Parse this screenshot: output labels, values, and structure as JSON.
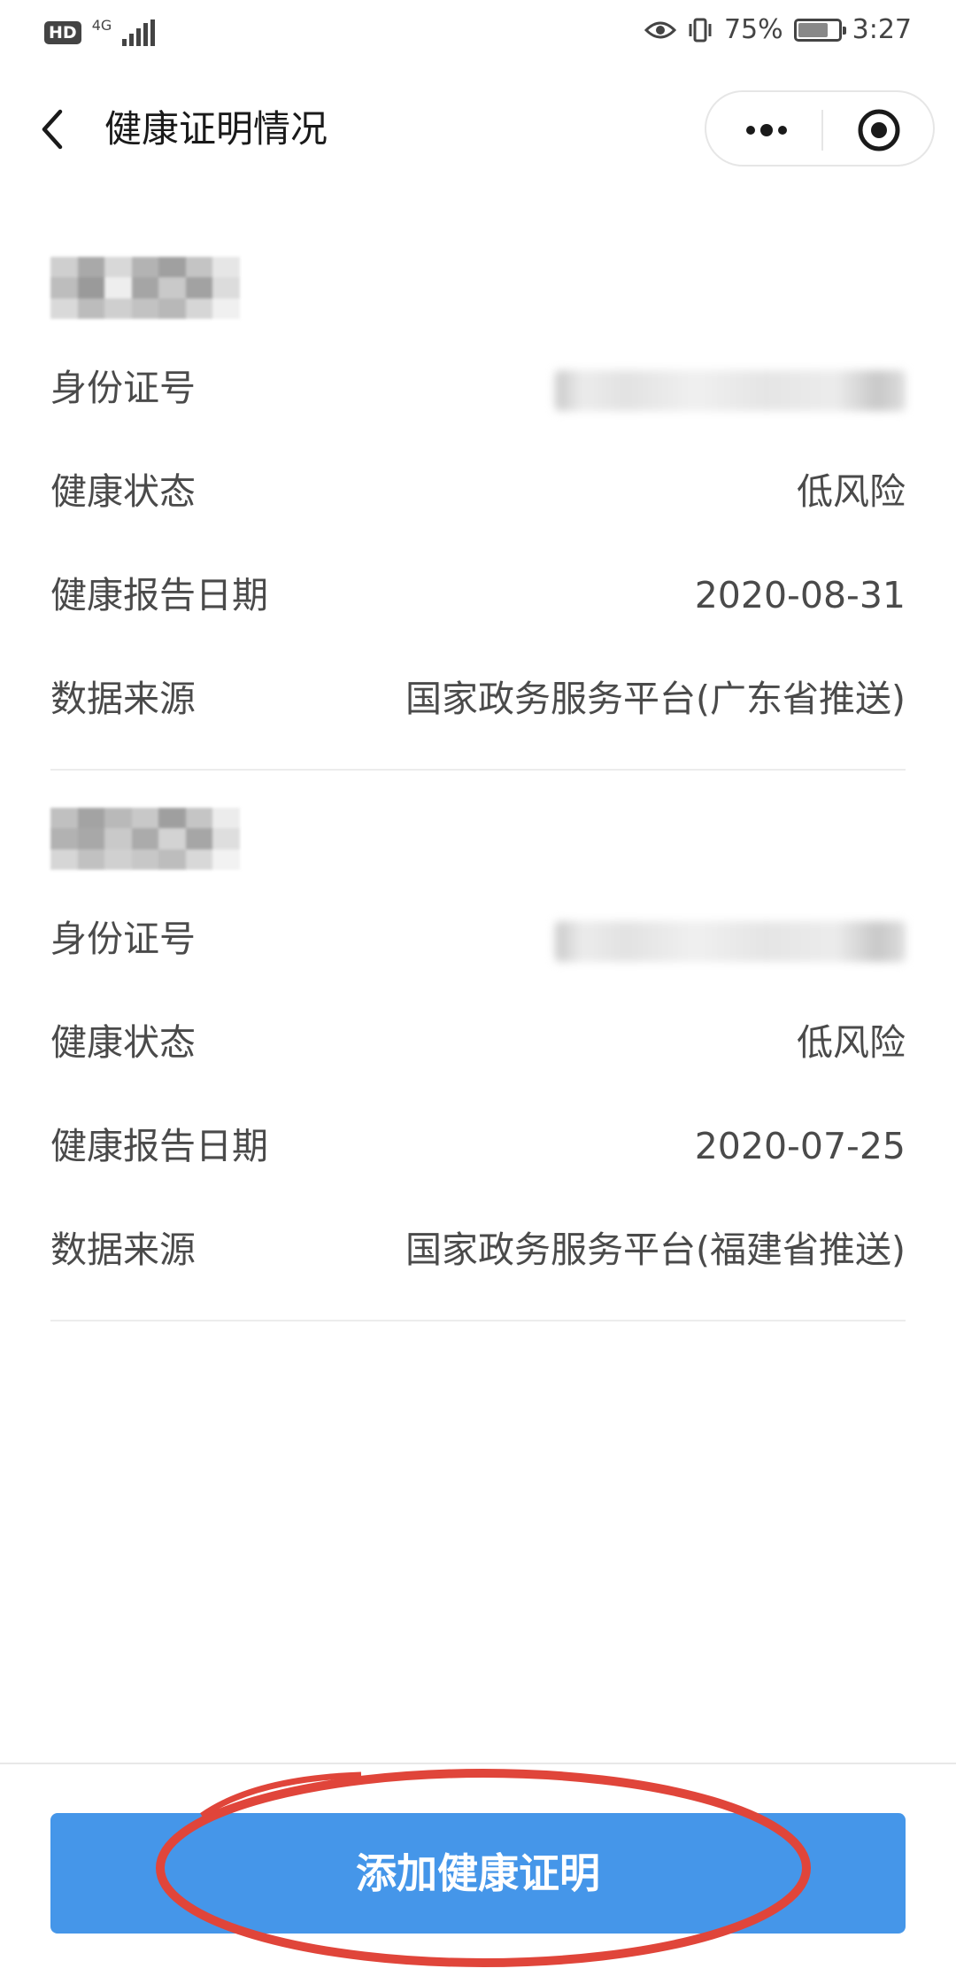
{
  "status_bar": {
    "hd": "HD",
    "network": "4G",
    "battery_text": "75%",
    "battery_level": 0.75,
    "time": "3:27"
  },
  "nav": {
    "title": "健康证明情况"
  },
  "records": [
    {
      "rows": [
        {
          "label": "身份证号",
          "value": ""
        },
        {
          "label": "健康状态",
          "value": "低风险"
        },
        {
          "label": "健康报告日期",
          "value": "2020-08-31"
        },
        {
          "label": "数据来源",
          "value": "国家政务服务平台(广东省推送)"
        }
      ]
    },
    {
      "rows": [
        {
          "label": "身份证号",
          "value": ""
        },
        {
          "label": "健康状态",
          "value": "低风险"
        },
        {
          "label": "健康报告日期",
          "value": "2020-07-25"
        },
        {
          "label": "数据来源",
          "value": "国家政务服务平台(福建省推送)"
        }
      ]
    }
  ],
  "button": {
    "label": "添加健康证明"
  },
  "colors": {
    "button": "#4596e9",
    "annotation": "#e0453a"
  }
}
